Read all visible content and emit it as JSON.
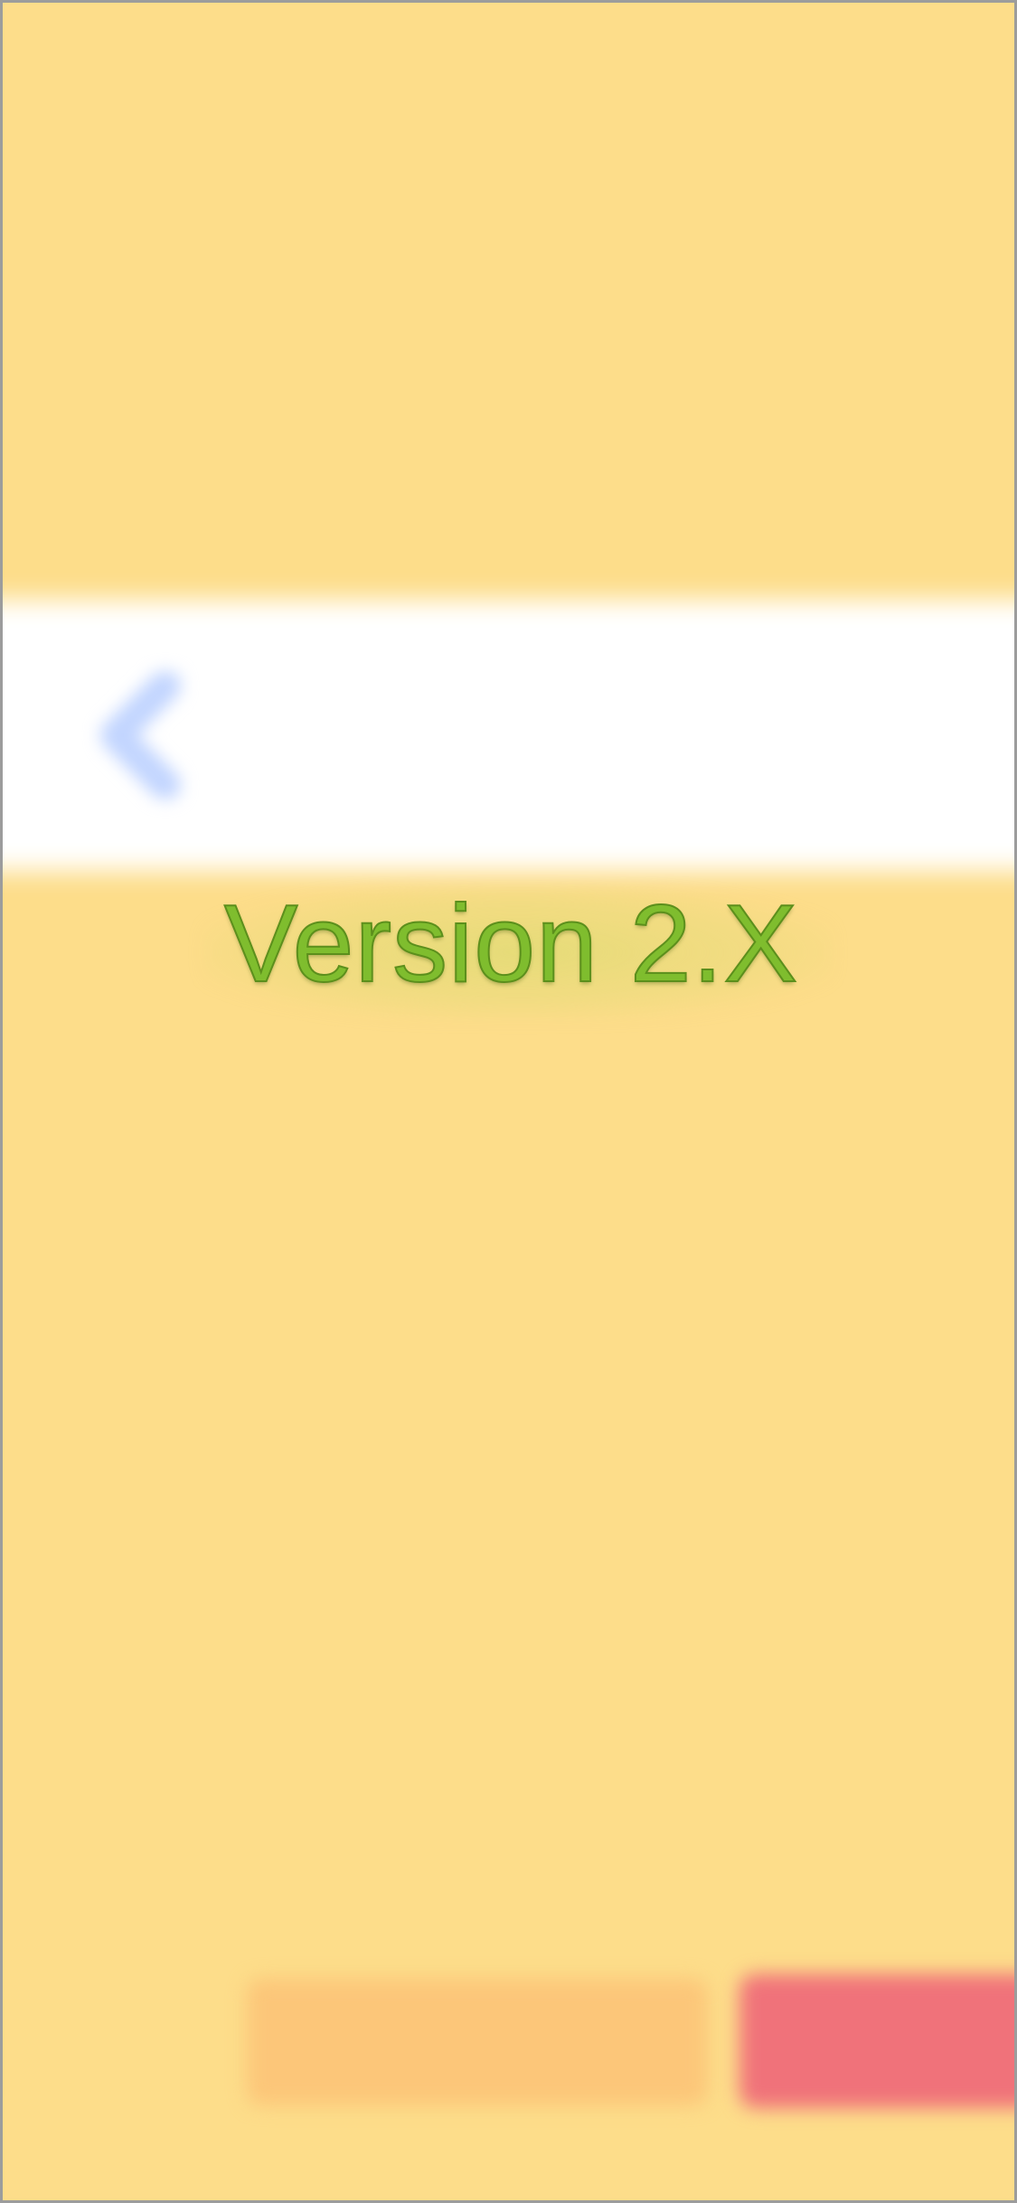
{
  "version": {
    "title": "Version 2.X"
  },
  "colors": {
    "background": "#fddd8a",
    "nav_background": "#ffffff",
    "nav_tint": "#c9d9ff",
    "version_text": "#7fbd2e",
    "left_button": "#fcc679",
    "right_button": "#f0727a"
  },
  "icons": {
    "back": "chevron-left-icon"
  }
}
